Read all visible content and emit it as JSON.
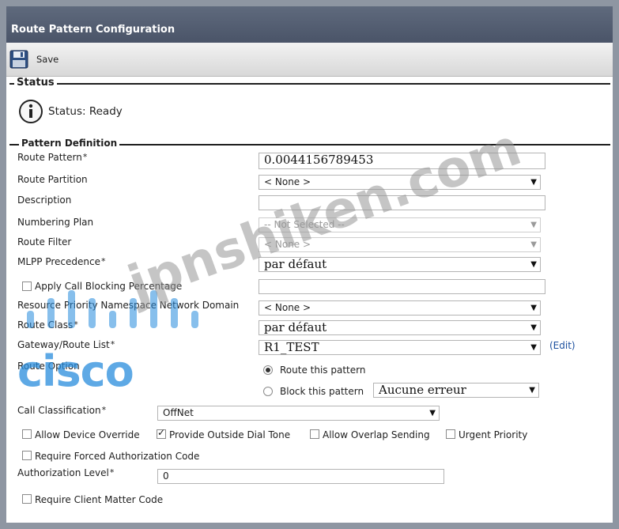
{
  "window": {
    "title": "Route Pattern Configuration"
  },
  "toolbar": {
    "save_label": "Save",
    "save_icon": "floppy-disk-icon"
  },
  "status": {
    "section_title": "Status",
    "text": "Status: Ready",
    "icon": "info-icon"
  },
  "pattern": {
    "section_title": "Pattern Definition",
    "route_pattern": {
      "label": "Route Pattern",
      "value": "0.0044156789453"
    },
    "route_partition": {
      "label": "Route Partition",
      "value": "< None >"
    },
    "description": {
      "label": "Description",
      "value": ""
    },
    "numbering_plan": {
      "label": "Numbering Plan",
      "value": "-- Not Selected --"
    },
    "route_filter": {
      "label": "Route Filter",
      "value": "< None >"
    },
    "mlpp_precedence": {
      "label": "MLPP Precedence",
      "value": "par défaut"
    },
    "apply_call_blocking": {
      "label": "Apply Call Blocking Percentage",
      "checked": false,
      "value": ""
    },
    "resource_priority": {
      "label": "Resource Priority Namespace Network Domain",
      "value": "< None >"
    },
    "route_class": {
      "label": "Route Class",
      "value": "par défaut"
    },
    "gateway_route_list": {
      "label": "Gateway/Route List",
      "value": "R1_TEST",
      "edit_link": "(Edit)"
    },
    "route_option": {
      "label": "Route Option",
      "route_this": "Route this pattern",
      "block_this": "Block this pattern",
      "block_reason": "Aucune erreur",
      "selected": "route"
    },
    "call_classification": {
      "label": "Call Classification",
      "value": "OffNet"
    },
    "allow_device_override": {
      "label": "Allow Device Override",
      "checked": false
    },
    "provide_outside_dial_tone": {
      "label": "Provide Outside Dial Tone",
      "checked": true
    },
    "allow_overlap_sending": {
      "label": "Allow Overlap Sending",
      "checked": false
    },
    "urgent_priority": {
      "label": "Urgent Priority",
      "checked": false
    },
    "require_forced_auth": {
      "label": "Require Forced Authorization Code",
      "checked": false
    },
    "authorization_level": {
      "label": "Authorization Level",
      "value": "0"
    },
    "require_client_matter": {
      "label": "Require Client Matter Code",
      "checked": false
    }
  },
  "required_marker": "*",
  "watermark": {
    "text": "jpnshiken.com",
    "logo_text": "cisco"
  }
}
